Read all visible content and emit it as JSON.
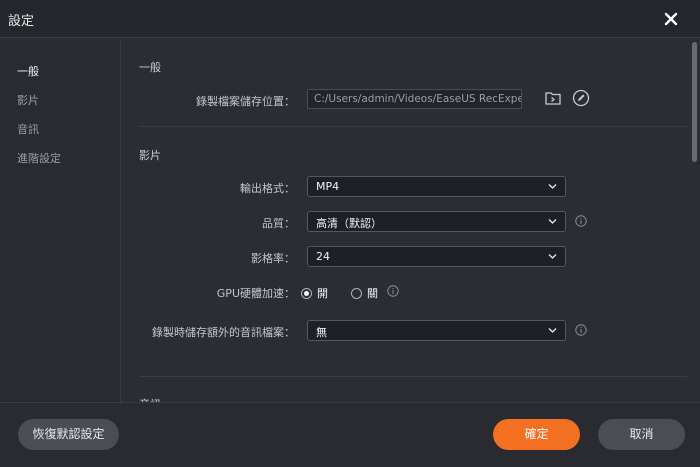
{
  "window": {
    "title": "設定"
  },
  "sidebar": {
    "items": [
      {
        "label": "一般",
        "active": true
      },
      {
        "label": "影片",
        "active": false
      },
      {
        "label": "音訊",
        "active": false
      },
      {
        "label": "進階設定",
        "active": false
      }
    ]
  },
  "general": {
    "title": "一般",
    "save_location_label": "錄製檔案儲存位置：",
    "save_location_value": "C:/Users/admin/Videos/EaseUS RecExperts"
  },
  "video": {
    "title": "影片",
    "format_label": "輸出格式：",
    "format_value": "MP4",
    "quality_label": "品質：",
    "quality_value": "高清（默認）",
    "framerate_label": "影格率：",
    "framerate_value": "24",
    "gpu_label": "GPU硬體加速：",
    "gpu_on_label": "開",
    "gpu_off_label": "關",
    "gpu_selected": "on",
    "extra_audio_label": "錄製時儲存額外的音訊檔案：",
    "extra_audio_value": "無"
  },
  "next_section": {
    "title": "音訊"
  },
  "footer": {
    "reset_label": "恢復默認設定",
    "ok_label": "確定",
    "cancel_label": "取消"
  },
  "colors": {
    "accent": "#f36f22",
    "background": "#2c2d33"
  },
  "icons": {
    "close": "close-icon",
    "folder": "folder-open-icon",
    "edit": "edit-icon",
    "info": "info-icon",
    "chevron": "chevron-down-icon"
  }
}
